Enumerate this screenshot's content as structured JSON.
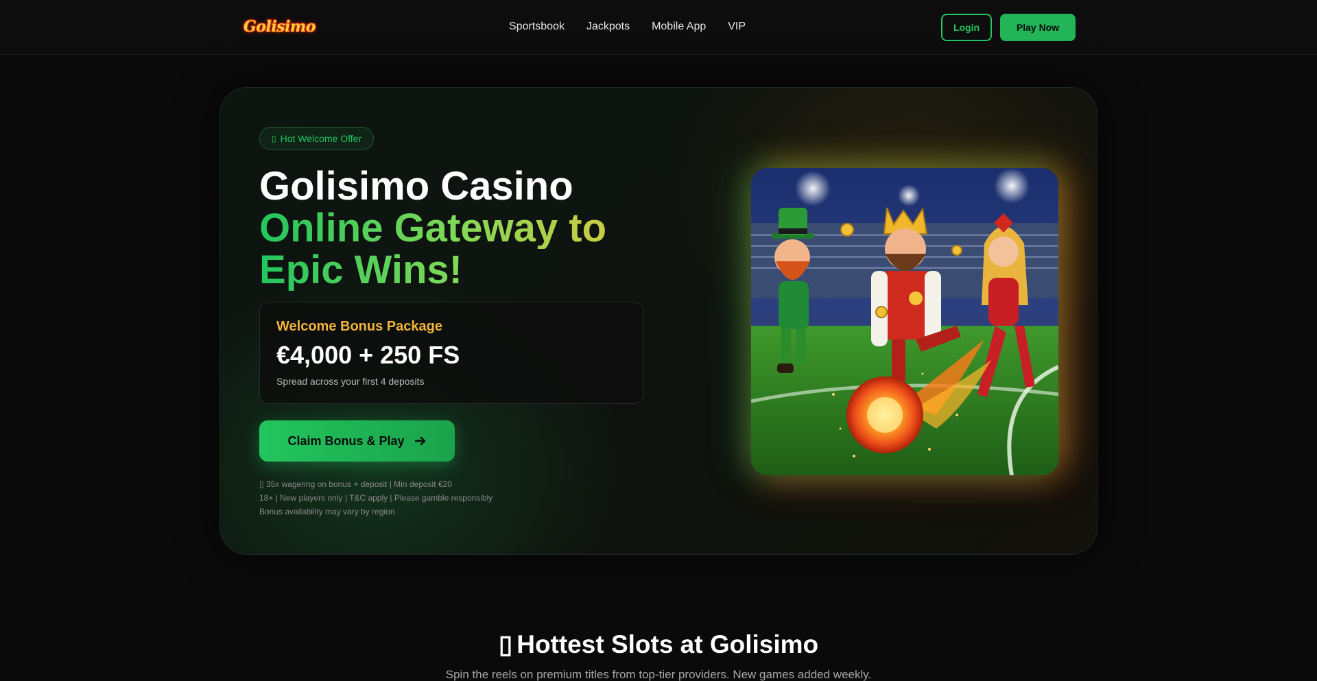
{
  "nav": {
    "logo_text": "Golisimo",
    "links": [
      "Sportsbook",
      "Jackpots",
      "Mobile App",
      "VIP"
    ],
    "login_label": "Login",
    "play_label": "Play Now"
  },
  "hero": {
    "badge_icon": "fire-icon",
    "badge_text": "Hot Welcome Offer",
    "title_line1": "Golisimo Casino",
    "title_line2": "Online Gateway to",
    "title_line3": "Epic Wins!",
    "bonus": {
      "label": "Welcome Bonus Package",
      "amount": "€4,000 + 250 FS",
      "sub": "Spread across your first 4 deposits"
    },
    "cta_label": "Claim Bonus & Play",
    "cta_icon": "arrow-right-icon",
    "terms": [
      "35x wagering on bonus + deposit | Min deposit €20",
      "18+ | New players only | T&C apply | Please gamble responsibly",
      "Bonus availability may vary by region"
    ],
    "image_alt": "Leprechaun, king and woman kicking a flaming football in a stadium"
  },
  "section": {
    "title": "Hottest Slots at Golisimo",
    "subtitle": "Spin the reels on premium titles from top-tier providers. New games added weekly."
  },
  "colors": {
    "accent_green": "#22c55e",
    "accent_gold": "#f3b43a",
    "background": "#0a0a0a"
  }
}
